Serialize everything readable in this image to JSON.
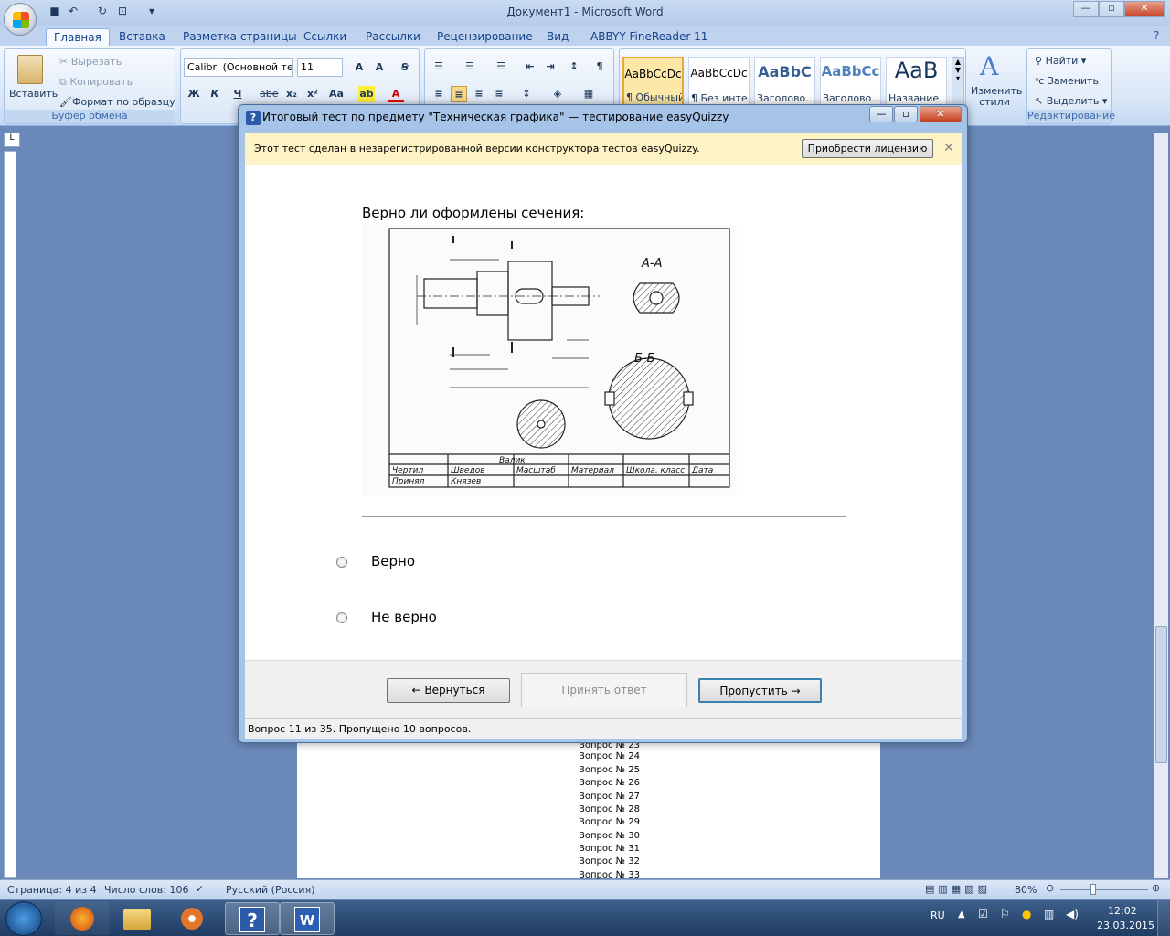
{
  "word": {
    "title": "Документ1 - Microsoft Word",
    "tabs": [
      "Главная",
      "Вставка",
      "Разметка страницы",
      "Ссылки",
      "Рассылки",
      "Рецензирование",
      "Вид",
      "ABBYY FineReader 11"
    ],
    "clipboard": {
      "paste": "Вставить",
      "cut": "Вырезать",
      "copy": "Копировать",
      "format_painter": "Формат по образцу",
      "group": "Буфер обмена"
    },
    "font": {
      "name": "Calibri (Основной те",
      "size": "11"
    },
    "styles": [
      {
        "preview": "AaBbCcDc",
        "name": "¶ Обычный"
      },
      {
        "preview": "AaBbCcDc",
        "name": "¶ Без инте..."
      },
      {
        "preview": "AaBbC",
        "name": "Заголово..."
      },
      {
        "preview": "AaBbCc",
        "name": "Заголово..."
      },
      {
        "preview": "AaB",
        "name": "Название"
      }
    ],
    "change_styles": "Изменить стили",
    "editing": {
      "find": "Найти",
      "replace": "Заменить",
      "select": "Выделить",
      "group": "Редактирование"
    },
    "doc_lines": [
      "Вопрос № 23",
      "Вопрос № 24",
      "Вопрос № 25",
      "Вопрос № 26",
      "Вопрос № 27",
      "Вопрос № 28",
      "Вопрос № 29",
      "Вопрос № 30",
      "Вопрос № 31",
      "Вопрос № 32",
      "Вопрос № 33"
    ],
    "status": {
      "page": "Страница: 4 из 4",
      "words": "Число слов: 106",
      "lang": "Русский (Россия)",
      "zoom": "80%"
    }
  },
  "taskbar": {
    "lang": "RU",
    "time": "12:02",
    "date": "23.03.2015"
  },
  "dialog": {
    "title": "Итоговый тест по предмету \"Техническая графика\" — тестирование easyQuizzy",
    "notice": "Этот тест сделан в незарегистрированной версии конструктора тестов easyQuizzy.",
    "license_button": "Приобрести лицензию",
    "question": "Верно ли оформлены сечения:",
    "options": [
      "Верно",
      "Не верно"
    ],
    "back": "← Вернуться",
    "accept": "Принять ответ",
    "skip": "Пропустить →",
    "status": "Вопрос 11 из 35. Пропущено 10 вопросов."
  },
  "drawing_labels": {
    "sec1": "А-А",
    "sec2": "Б-Б",
    "title": "Валик",
    "row1": [
      "Чертил",
      "Шведов",
      "Масштаб",
      "Материал",
      "Школа, класс",
      "Дата"
    ],
    "row2": [
      "Принял",
      "Князев"
    ]
  }
}
